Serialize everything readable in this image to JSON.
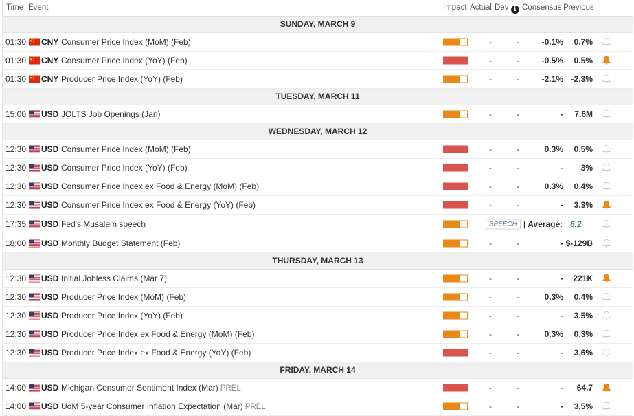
{
  "header": {
    "time": "Time",
    "event": "Event",
    "impact": "Impact",
    "actual": "Actual",
    "dev": "Dev",
    "consensus": "Consensus",
    "previous": "Previous"
  },
  "colors": {
    "high": "#d9534f",
    "medium": "#e8891a",
    "bell_active": "#e8891a",
    "bell_inactive": "#cccccc"
  },
  "days": [
    {
      "label": "SUNDAY, MARCH 9",
      "events": [
        {
          "time": "01:30",
          "flag": "cn",
          "currency": "CNY",
          "name": "Consumer Price Index (MoM) (Feb)",
          "impact": "medium",
          "actual": "-",
          "dev": "-",
          "consensus": "-0.1%",
          "previous": "0.7%",
          "alert": false
        },
        {
          "time": "01:30",
          "flag": "cn",
          "currency": "CNY",
          "name": "Consumer Price Index (YoY) (Feb)",
          "impact": "high",
          "actual": "-",
          "dev": "-",
          "consensus": "-0.5%",
          "previous": "0.5%",
          "alert": true
        },
        {
          "time": "01:30",
          "flag": "cn",
          "currency": "CNY",
          "name": "Producer Price Index (YoY) (Feb)",
          "impact": "medium",
          "actual": "-",
          "dev": "-",
          "consensus": "-2.1%",
          "previous": "-2.3%",
          "alert": false
        }
      ]
    },
    {
      "label": "TUESDAY, MARCH 11",
      "events": [
        {
          "time": "15:00",
          "flag": "us",
          "currency": "USD",
          "name": "JOLTS Job Openings (Jan)",
          "impact": "medium",
          "actual": "-",
          "dev": "-",
          "consensus": "-",
          "previous": "7.6M",
          "alert": false
        }
      ]
    },
    {
      "label": "WEDNESDAY, MARCH 12",
      "events": [
        {
          "time": "12:30",
          "flag": "us",
          "currency": "USD",
          "name": "Consumer Price Index (MoM) (Feb)",
          "impact": "high",
          "actual": "-",
          "dev": "-",
          "consensus": "0.3%",
          "previous": "0.5%",
          "alert": false
        },
        {
          "time": "12:30",
          "flag": "us",
          "currency": "USD",
          "name": "Consumer Price Index (YoY) (Feb)",
          "impact": "high",
          "actual": "-",
          "dev": "-",
          "consensus": "-",
          "previous": "3%",
          "alert": false
        },
        {
          "time": "12:30",
          "flag": "us",
          "currency": "USD",
          "name": "Consumer Price Index ex Food & Energy (MoM) (Feb)",
          "impact": "high",
          "actual": "-",
          "dev": "-",
          "consensus": "0.3%",
          "previous": "0.4%",
          "alert": false
        },
        {
          "time": "12:30",
          "flag": "us",
          "currency": "USD",
          "name": "Consumer Price Index ex Food & Energy (YoY) (Feb)",
          "impact": "high",
          "actual": "-",
          "dev": "-",
          "consensus": "-",
          "previous": "3.3%",
          "alert": true
        },
        {
          "time": "17:35",
          "flag": "us",
          "currency": "USD",
          "name": "Fed's Musalem speech",
          "impact": "medium",
          "speech": "SPEECH",
          "average_label": "Average:",
          "average_value": "6.2",
          "alert": false
        },
        {
          "time": "18:00",
          "flag": "us",
          "currency": "USD",
          "name": "Monthly Budget Statement (Feb)",
          "impact": "medium",
          "actual": "-",
          "dev": "-",
          "consensus": "-",
          "previous": "$-129B",
          "alert": false
        }
      ]
    },
    {
      "label": "THURSDAY, MARCH 13",
      "events": [
        {
          "time": "12:30",
          "flag": "us",
          "currency": "USD",
          "name": "Initial Jobless Claims (Mar 7)",
          "impact": "medium",
          "actual": "-",
          "dev": "-",
          "consensus": "-",
          "previous": "221K",
          "alert": true
        },
        {
          "time": "12:30",
          "flag": "us",
          "currency": "USD",
          "name": "Producer Price Index (MoM) (Feb)",
          "impact": "medium",
          "actual": "-",
          "dev": "-",
          "consensus": "0.3%",
          "previous": "0.4%",
          "alert": false
        },
        {
          "time": "12:30",
          "flag": "us",
          "currency": "USD",
          "name": "Producer Price Index (YoY) (Feb)",
          "impact": "medium",
          "actual": "-",
          "dev": "-",
          "consensus": "-",
          "previous": "3.5%",
          "alert": false
        },
        {
          "time": "12:30",
          "flag": "us",
          "currency": "USD",
          "name": "Producer Price Index ex Food & Energy (MoM) (Feb)",
          "impact": "medium",
          "actual": "-",
          "dev": "-",
          "consensus": "0.3%",
          "previous": "0.3%",
          "alert": false
        },
        {
          "time": "12:30",
          "flag": "us",
          "currency": "USD",
          "name": "Producer Price Index ex Food & Energy (YoY) (Feb)",
          "impact": "high",
          "actual": "-",
          "dev": "-",
          "consensus": "-",
          "previous": "3.6%",
          "alert": false
        }
      ]
    },
    {
      "label": "FRIDAY, MARCH 14",
      "events": [
        {
          "time": "14:00",
          "flag": "us",
          "currency": "USD",
          "name": "Michigan Consumer Sentiment Index (Mar)",
          "tag": "PREL",
          "impact": "high",
          "actual": "-",
          "dev": "-",
          "consensus": "-",
          "previous": "64.7",
          "alert": true
        },
        {
          "time": "14:00",
          "flag": "us",
          "currency": "USD",
          "name": "UoM 5-year Consumer Inflation Expectation (Mar)",
          "tag": "PREL",
          "impact": "medium",
          "actual": "-",
          "dev": "-",
          "consensus": "-",
          "previous": "3.5%",
          "alert": false
        }
      ]
    }
  ]
}
